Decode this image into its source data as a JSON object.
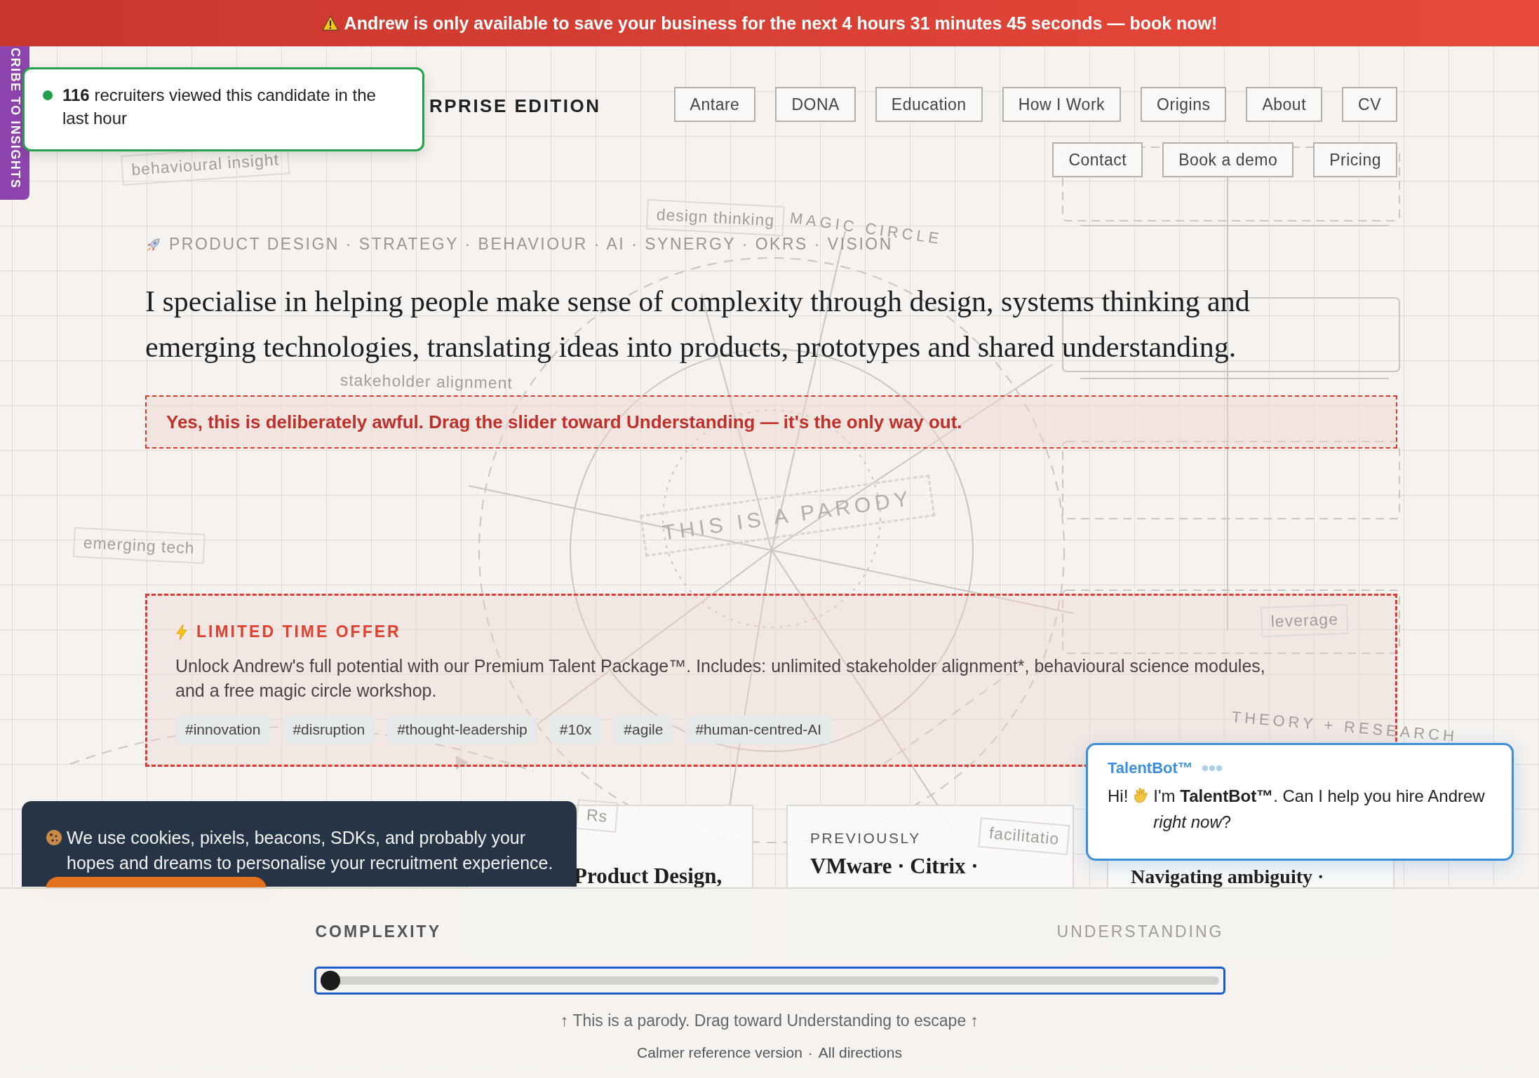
{
  "banner": {
    "text": "Andrew is only available to save your business for the next 4 hours 31 minutes 45 seconds — book now!"
  },
  "side_tab": {
    "label": "CRIBE TO INSIGHTS"
  },
  "toast": {
    "text": "**116** recruiters viewed this candidate in the last hour"
  },
  "brand": "RPRISE EDITION",
  "nav": [
    {
      "label": "Antare"
    },
    {
      "label": "DONA"
    },
    {
      "label": "Education"
    },
    {
      "label": "How I Work"
    },
    {
      "label": "Origins"
    },
    {
      "label": "About"
    },
    {
      "label": "CV"
    },
    {
      "label": "Contact"
    },
    {
      "label": "Book a demo"
    },
    {
      "label": "Pricing"
    }
  ],
  "sketch_labels": [
    {
      "text": "behavioural insight",
      "kind": "boxed"
    },
    {
      "text": "design thinking",
      "kind": "boxed"
    },
    {
      "text": "MAGIC CIRCLE",
      "kind": "caps"
    },
    {
      "text": "stakeholder alignment",
      "kind": "plain"
    },
    {
      "text": "emerging tech",
      "kind": "boxed"
    },
    {
      "text": "THIS IS A PARODY",
      "kind": "stamp"
    },
    {
      "text": "leverage",
      "kind": "boxed"
    },
    {
      "text": "THEORY + RESEARCH",
      "kind": "caps"
    },
    {
      "text": "facilitatio",
      "kind": "boxed"
    },
    {
      "text": "Rs",
      "kind": "boxed"
    }
  ],
  "tagline": "PRODUCT DESIGN · STRATEGY · BEHAVIOUR · AI · SYNERGY · OKRS · VISION",
  "headline": "I specialise in helping people make sense of complexity through design, systems thinking and emerging technologies, translating ideas into products, prototypes and shared understanding.",
  "warning": "Yes, this is deliberately awful. Drag the slider toward Understanding — it's the only way out.",
  "offer": {
    "heading": "LIMITED TIME OFFER",
    "body": "Unlock Andrew's full potential with our Premium Talent Package™. Includes: unlimited stakeholder alignment*, behavioural science modules, and a free magic circle workshop.",
    "tags": [
      "#innovation",
      "#disruption",
      "#thought-leadership",
      "#10x",
      "#agile",
      "#human-centred-AI"
    ]
  },
  "cards": [
    {
      "title": "Product Design,"
    },
    {
      "label": "PREVIOUSLY",
      "title": "VMware · Citrix ·"
    },
    {
      "title": "Navigating ambiguity ·"
    }
  ],
  "cookie_banner": {
    "text": "We use cookies, pixels, beacons, SDKs, and probably your hopes and dreams to personalise your recruitment experience."
  },
  "chatbot": {
    "name": "TalentBot™",
    "greeting": "Hi!",
    "message": "I'm **TalentBot™**. Can I help you hire Andrew *right now*?"
  },
  "slider": {
    "left_label": "COMPLEXITY",
    "right_label": "UNDERSTANDING",
    "level": 0
  },
  "hint": "↑ This is a parody. Drag toward Understanding to escape ↑",
  "footer": {
    "links": [
      "Calmer reference version",
      "All directions"
    ],
    "separator": "·"
  }
}
